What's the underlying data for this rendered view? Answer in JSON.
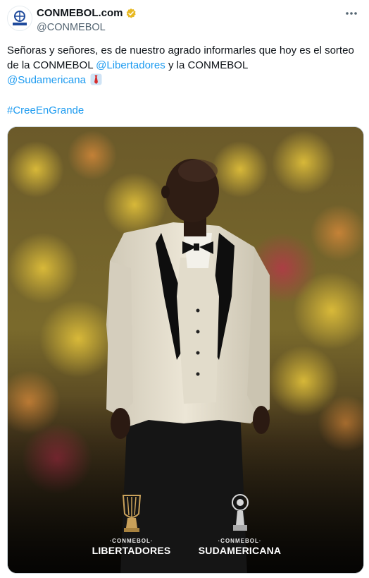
{
  "tweet": {
    "author": {
      "display_name": "CONMEBOL.com",
      "handle": "@CONMEBOL",
      "avatar_text": "CONMEBOL",
      "verified_color": "#e8b923"
    },
    "text": {
      "part1": "Señoras y señores, es de nuestro agrado informarles que hoy es el sorteo de la CONMEBOL ",
      "mention1": "@Libertadores",
      "part2": " y la CONMEBOL ",
      "mention2": "@Sudamericana",
      "emoji": "necktie-emoji"
    },
    "hashtag": "#CreeEnGrande",
    "more_icon": "ellipsis-icon",
    "link_color": "#1d9bf0"
  },
  "media": {
    "logos": [
      {
        "org": "·CONMEBOL·",
        "competition": "LIBERTADORES",
        "color": "#c9a15a"
      },
      {
        "org": "·CONMEBOL·",
        "competition": "SUDAMERICANA",
        "color": "#d9d9d9"
      }
    ]
  }
}
